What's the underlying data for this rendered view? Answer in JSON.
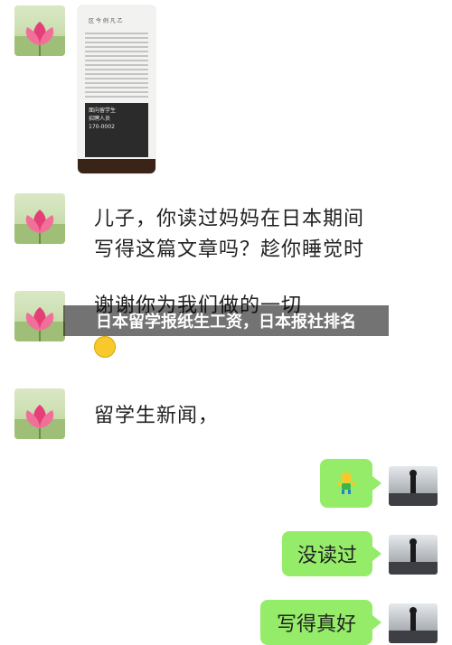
{
  "messages": [
    {
      "id": "m1",
      "sender": "other",
      "type": "image",
      "content": "newspaper-photo"
    },
    {
      "id": "m2",
      "sender": "other",
      "type": "text",
      "lines": [
        "儿子，你读过妈妈在日本期间",
        "写得这篇文章吗？趁你睡觉时"
      ]
    },
    {
      "id": "m3",
      "sender": "other",
      "type": "text",
      "lines": [
        "谢谢你为我们做的一切"
      ]
    },
    {
      "id": "m4",
      "sender": "other",
      "type": "text",
      "lines": [
        "留学生新闻，"
      ]
    },
    {
      "id": "m5",
      "sender": "self",
      "type": "emoji",
      "content": "dancing-person-emoji"
    },
    {
      "id": "m6",
      "sender": "self",
      "type": "text",
      "text": "没读过"
    },
    {
      "id": "m7",
      "sender": "self",
      "type": "text",
      "text": "写得真好"
    }
  ],
  "newspaper": {
    "header": "区 今 例 凡 乙",
    "ad_title": "面向留学生",
    "ad_subtitle": "招聘人员",
    "ad_phone": "170-0002"
  },
  "banner": {
    "title": "日本留学报纸生工资，日本报社排名"
  },
  "colors": {
    "self_bubble": "#95ec69",
    "banner_bg": "rgba(0,0,0,0.55)"
  }
}
